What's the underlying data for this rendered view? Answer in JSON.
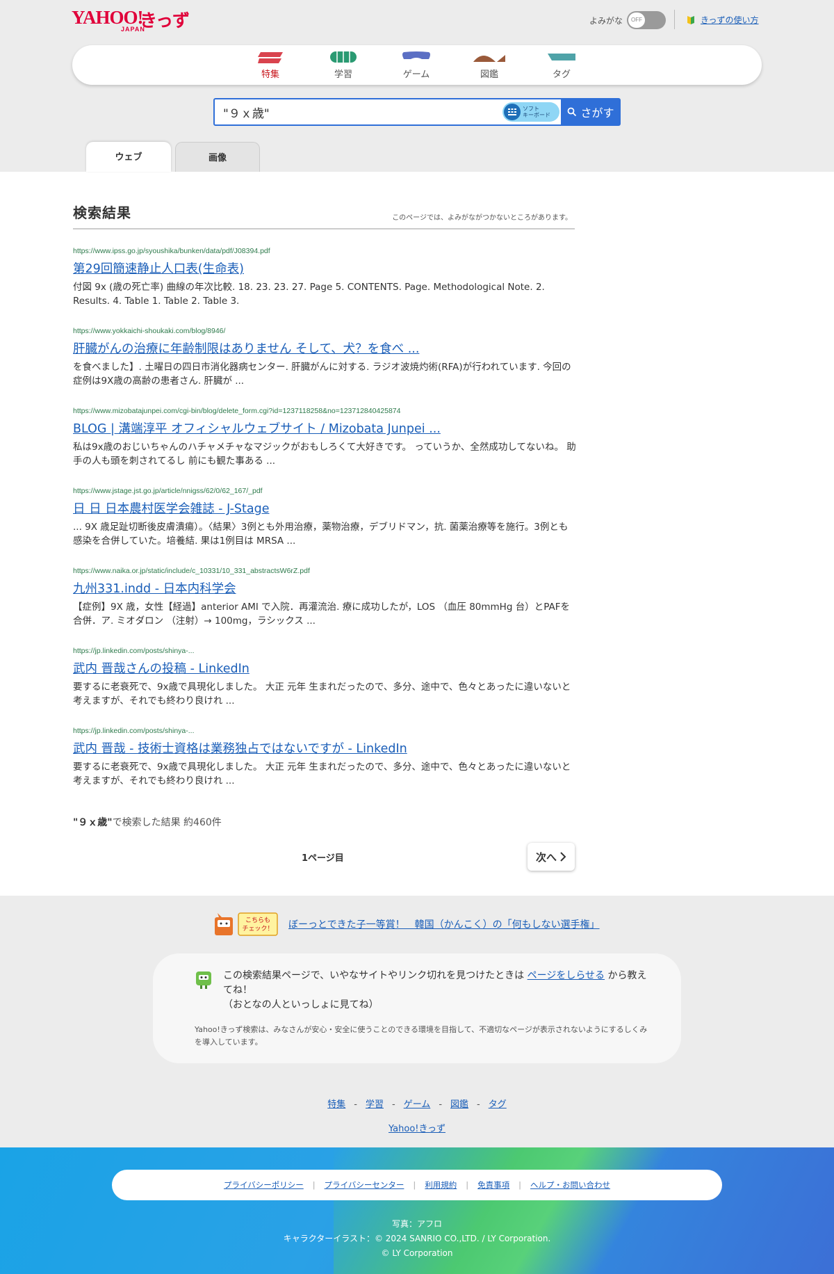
{
  "header": {
    "logo_yahoo": "YAHOO!",
    "logo_kids": "きっず",
    "logo_japan": "JAPAN",
    "yomigana_label": "よみがな",
    "yomigana_toggle": "OFF",
    "howto_link": "きっずの使い方"
  },
  "nav": {
    "items": [
      {
        "label": "特集"
      },
      {
        "label": "学習"
      },
      {
        "label": "ゲーム"
      },
      {
        "label": "図鑑"
      },
      {
        "label": "タグ"
      }
    ]
  },
  "search": {
    "query": "\"９ｘ歳\"",
    "softkb_line1": "ソフト",
    "softkb_line2": "キーボード",
    "button_label": "さがす"
  },
  "tabs": {
    "web": "ウェブ",
    "image": "画像"
  },
  "results": {
    "title": "検索結果",
    "note": "このページでは、よみがながつかないところがあります。",
    "items": [
      {
        "url": "https://www.ipss.go.jp/syoushika/bunken/data/pdf/J08394.pdf",
        "title": "第29回簡速静止人口表(生命表)",
        "snippet": "付図 9x (歳の死亡率) 曲線の年次比較. 18. 23. 23. 27. Page 5. CONTENTS. Page. Methodological Note. 2. Results. 4. Table 1. Table 2. Table 3."
      },
      {
        "url": "https://www.yokkaichi-shoukaki.com/blog/8946/",
        "title": "肝臓がんの治療に年齢制限はありません そして、犬？を食べ ...",
        "snippet": "を食べました】. 土曜日の四日市消化器病センター. 肝臓がんに対する. ラジオ波焼灼術(RFA)が行われています. 今回の症例は9X歳の高齢の患者さん. 肝臓が ..."
      },
      {
        "url": "https://www.mizobatajunpei.com/cgi-bin/blog/delete_form.cgi?id=1237118258&no=123712840425874",
        "title": "BLOG | 溝端淳平 オフィシャルウェブサイト / Mizobata Junpei ...",
        "snippet": "私は9x歳のおじいちゃんのハチャメチャなマジックがおもしろくて大好きです。 っていうか、全然成功してないね。 助手の人も頭を刺されてるし 前にも観た事ある ..."
      },
      {
        "url": "https://www.jstage.jst.go.jp/article/nnigss/62/0/62_167/_pdf",
        "title": "日 日 日本農村医学会雑誌 - J-Stage",
        "snippet": "... 9X 歳足趾切断後皮膚潰瘍）。〈結果〉3例とも外用治療，薬物治療，デブリドマン，抗. 菌薬治療等を施行。3例とも感染を合併していた。培養結. 果は1例目は MRSA ..."
      },
      {
        "url": "https://www.naika.or.jp/static/include/c_10331/10_331_abstractsW6rZ.pdf",
        "title": "九州331.indd - 日本内科学会",
        "snippet": "【症例】9X 歳，女性【経過】anterior AMI で入院．再灌流治. 療に成功したが，LOS （血圧 80mmHg 台）とPAFを合併．ア. ミオダロン （注射）→ 100mg，ラシックス ..."
      },
      {
        "url": "https://jp.linkedin.com/posts/shinya-...",
        "title": "武内 晋哉さんの投稿 - LinkedIn",
        "snippet": "要するに老衰死で、9x歳で具現化しました。 大正 元年 生まれだったので、多分、途中で、色々とあったに違いないと考えますが、それでも終わり良けれ ..."
      },
      {
        "url": "https://jp.linkedin.com/posts/shinya-...",
        "title": "武内 晋哉 - 技術士資格は業務独占ではないですが - LinkedIn",
        "snippet": "要するに老衰死で、9x歳で具現化しました。 大正 元年 生まれだったので、多分、途中で、色々とあったに違いないと考えますが、それでも終わり良けれ ..."
      }
    ],
    "count_query": "\"９ｘ歳\"",
    "count_text": "で検索した結果 約460件",
    "page_label": "1ページ目",
    "next_label": "次へ"
  },
  "info": {
    "promo_badge_line1": "こちらも",
    "promo_badge_line2": "チェック！",
    "promo_link": "ぼーっとできた子一等賞！　韓国（かんこく）の「何もしない選手権」",
    "report_text_before": "この検索結果ページで、いやなサイトやリンク切れを見つけたときは ",
    "report_link": "ページをしらせる",
    "report_text_after": " から教えてね！",
    "report_text_line2": "（おとなの人といっしょに見てね）",
    "report_sub": "Yahoo!きっず検索は、みなさんが安心・安全に使うことのできる環境を目指して、不適切なページが表示されないようにするしくみを導入しています。",
    "footer_links": [
      "特集",
      "学習",
      "ゲーム",
      "図鑑",
      "タグ"
    ],
    "footer_home": "Yahoo!きっず"
  },
  "footer": {
    "legal": [
      "プライバシーポリシー",
      "プライバシーセンター",
      "利用規約",
      "免責事項",
      "ヘルプ・お問い合わせ"
    ],
    "credit_photo": "写真：アフロ",
    "credit_illust": "キャラクターイラスト：© 2024 SANRIO CO.,LTD. / LY Corporation.",
    "copyright": "© LY Corporation"
  },
  "colors": {
    "brand_red": "#e0003a",
    "link_blue": "#1a5eb8",
    "url_green": "#2d7a4b",
    "search_blue": "#2f6fd8"
  }
}
